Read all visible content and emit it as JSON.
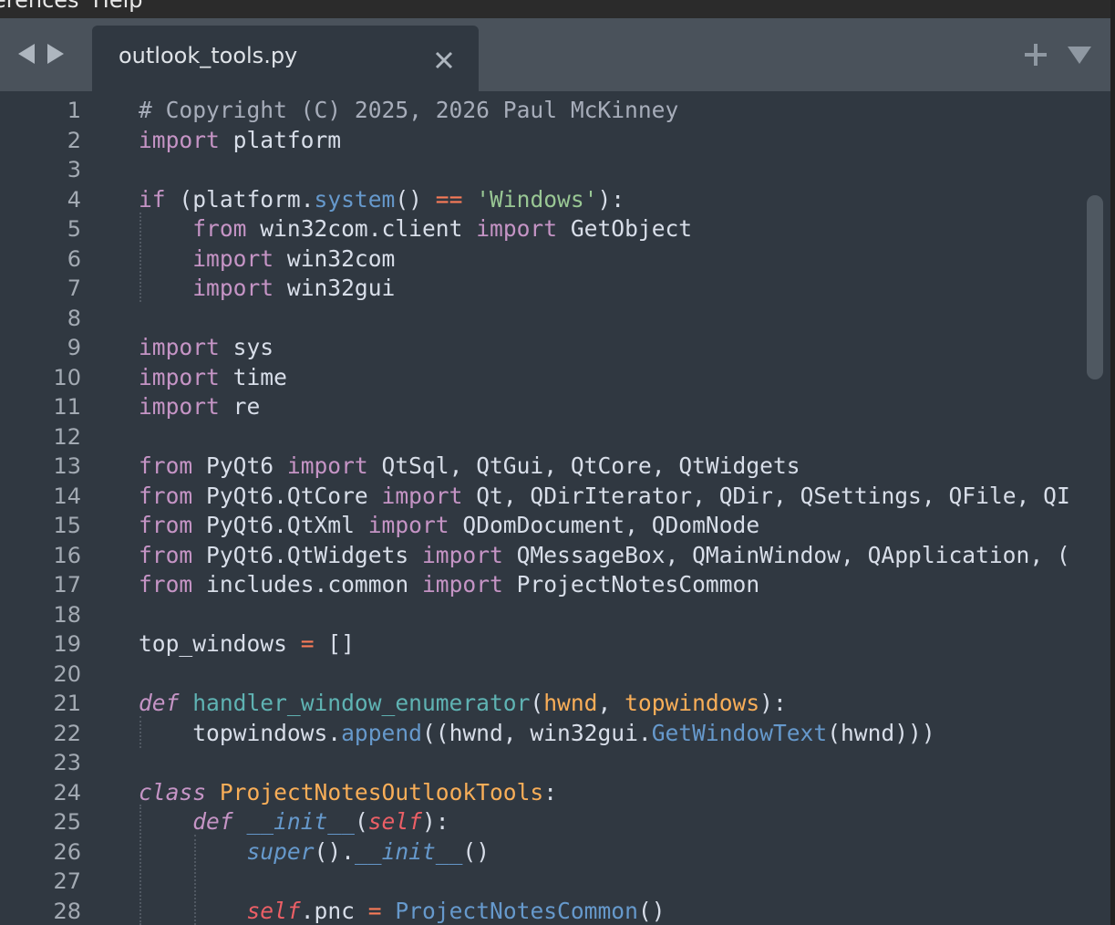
{
  "menubar": {
    "text": "erences  Help"
  },
  "tabs": [
    {
      "label": "outlook_tools.py",
      "close_icon": "close-icon",
      "active": true
    }
  ],
  "icons": {
    "back": "chevron-left-icon",
    "forward": "chevron-right-icon",
    "new_tab": "plus-icon",
    "tab_menu": "chevron-down-icon"
  },
  "theme": {
    "background": "#303841",
    "tabbar": "#4a525b",
    "comment": "#a7adba",
    "keyword": "#c594c5",
    "string": "#99c794",
    "operator": "#f97b58",
    "function": "#5fb3b3",
    "method": "#6699cc",
    "parameter": "#f9ae58",
    "self": "#ec5f66"
  },
  "editor": {
    "lines": [
      {
        "n": "1",
        "tokens": [
          [
            "comment",
            "# Copyright (C) 2025, 2026 Paul McKinney"
          ]
        ]
      },
      {
        "n": "2",
        "tokens": [
          [
            "kw",
            "import"
          ],
          [
            "plain",
            " platform"
          ]
        ]
      },
      {
        "n": "3",
        "tokens": []
      },
      {
        "n": "4",
        "tokens": [
          [
            "kw",
            "if"
          ],
          [
            "plain",
            " (platform"
          ],
          [
            "punc",
            "."
          ],
          [
            "method",
            "system"
          ],
          [
            "plain",
            "() "
          ],
          [
            "op",
            "=="
          ],
          [
            "plain",
            " "
          ],
          [
            "str",
            "'Windows'"
          ],
          [
            "plain",
            "):"
          ]
        ]
      },
      {
        "n": "5",
        "tokens": [
          [
            "plain",
            "    "
          ],
          [
            "kw",
            "from"
          ],
          [
            "plain",
            " win32com"
          ],
          [
            "punc",
            "."
          ],
          [
            "plain",
            "client "
          ],
          [
            "kw",
            "import"
          ],
          [
            "plain",
            " GetObject"
          ]
        ]
      },
      {
        "n": "6",
        "tokens": [
          [
            "plain",
            "    "
          ],
          [
            "kw",
            "import"
          ],
          [
            "plain",
            " win32com"
          ]
        ]
      },
      {
        "n": "7",
        "tokens": [
          [
            "plain",
            "    "
          ],
          [
            "kw",
            "import"
          ],
          [
            "plain",
            " win32gui"
          ]
        ]
      },
      {
        "n": "8",
        "tokens": []
      },
      {
        "n": "9",
        "tokens": [
          [
            "kw",
            "import"
          ],
          [
            "plain",
            " sys"
          ]
        ]
      },
      {
        "n": "10",
        "tokens": [
          [
            "kw",
            "import"
          ],
          [
            "plain",
            " time"
          ]
        ]
      },
      {
        "n": "11",
        "tokens": [
          [
            "kw",
            "import"
          ],
          [
            "plain",
            " re"
          ]
        ]
      },
      {
        "n": "12",
        "tokens": []
      },
      {
        "n": "13",
        "tokens": [
          [
            "kw",
            "from"
          ],
          [
            "plain",
            " PyQt6 "
          ],
          [
            "kw",
            "import"
          ],
          [
            "plain",
            " QtSql"
          ],
          [
            "punc",
            ","
          ],
          [
            "plain",
            " QtGui"
          ],
          [
            "punc",
            ","
          ],
          [
            "plain",
            " QtCore"
          ],
          [
            "punc",
            ","
          ],
          [
            "plain",
            " QtWidgets"
          ]
        ]
      },
      {
        "n": "14",
        "tokens": [
          [
            "kw",
            "from"
          ],
          [
            "plain",
            " PyQt6"
          ],
          [
            "punc",
            "."
          ],
          [
            "plain",
            "QtCore "
          ],
          [
            "kw",
            "import"
          ],
          [
            "plain",
            " Qt"
          ],
          [
            "punc",
            ","
          ],
          [
            "plain",
            " QDirIterator"
          ],
          [
            "punc",
            ","
          ],
          [
            "plain",
            " QDir"
          ],
          [
            "punc",
            ","
          ],
          [
            "plain",
            " QSettings"
          ],
          [
            "punc",
            ","
          ],
          [
            "plain",
            " QFile"
          ],
          [
            "punc",
            ","
          ],
          [
            "plain",
            " QI"
          ]
        ]
      },
      {
        "n": "15",
        "tokens": [
          [
            "kw",
            "from"
          ],
          [
            "plain",
            " PyQt6"
          ],
          [
            "punc",
            "."
          ],
          [
            "plain",
            "QtXml "
          ],
          [
            "kw",
            "import"
          ],
          [
            "plain",
            " QDomDocument"
          ],
          [
            "punc",
            ","
          ],
          [
            "plain",
            " QDomNode"
          ]
        ]
      },
      {
        "n": "16",
        "tokens": [
          [
            "kw",
            "from"
          ],
          [
            "plain",
            " PyQt6"
          ],
          [
            "punc",
            "."
          ],
          [
            "plain",
            "QtWidgets "
          ],
          [
            "kw",
            "import"
          ],
          [
            "plain",
            " QMessageBox"
          ],
          [
            "punc",
            ","
          ],
          [
            "plain",
            " QMainWindow"
          ],
          [
            "punc",
            ","
          ],
          [
            "plain",
            " QApplication"
          ],
          [
            "punc",
            ","
          ],
          [
            "plain",
            " ("
          ]
        ]
      },
      {
        "n": "17",
        "tokens": [
          [
            "kw",
            "from"
          ],
          [
            "plain",
            " includes"
          ],
          [
            "punc",
            "."
          ],
          [
            "plain",
            "common "
          ],
          [
            "kw",
            "import"
          ],
          [
            "plain",
            " ProjectNotesCommon"
          ]
        ]
      },
      {
        "n": "18",
        "tokens": []
      },
      {
        "n": "19",
        "tokens": [
          [
            "plain",
            "top_windows "
          ],
          [
            "op",
            "="
          ],
          [
            "plain",
            " []"
          ]
        ]
      },
      {
        "n": "20",
        "tokens": []
      },
      {
        "n": "21",
        "tokens": [
          [
            "def",
            "def"
          ],
          [
            "plain",
            " "
          ],
          [
            "fn",
            "handler_window_enumerator"
          ],
          [
            "plain",
            "("
          ],
          [
            "param",
            "hwnd"
          ],
          [
            "punc",
            ","
          ],
          [
            "plain",
            " "
          ],
          [
            "param",
            "topwindows"
          ],
          [
            "plain",
            "):"
          ]
        ]
      },
      {
        "n": "22",
        "tokens": [
          [
            "plain",
            "    topwindows"
          ],
          [
            "punc",
            "."
          ],
          [
            "method",
            "append"
          ],
          [
            "plain",
            "((hwnd"
          ],
          [
            "punc",
            ","
          ],
          [
            "plain",
            " win32gui"
          ],
          [
            "punc",
            "."
          ],
          [
            "method",
            "GetWindowText"
          ],
          [
            "plain",
            "(hwnd)))"
          ]
        ]
      },
      {
        "n": "23",
        "tokens": []
      },
      {
        "n": "24",
        "tokens": [
          [
            "def",
            "class"
          ],
          [
            "plain",
            " "
          ],
          [
            "class",
            "ProjectNotesOutlookTools"
          ],
          [
            "plain",
            ":"
          ]
        ]
      },
      {
        "n": "25",
        "tokens": [
          [
            "plain",
            "    "
          ],
          [
            "def",
            "def"
          ],
          [
            "plain",
            " "
          ],
          [
            "magic",
            "__init__"
          ],
          [
            "plain",
            "("
          ],
          [
            "self",
            "self"
          ],
          [
            "plain",
            "):"
          ]
        ]
      },
      {
        "n": "26",
        "tokens": [
          [
            "plain",
            "        "
          ],
          [
            "magic",
            "super"
          ],
          [
            "plain",
            "()"
          ],
          [
            "punc",
            "."
          ],
          [
            "magic",
            "__init__"
          ],
          [
            "plain",
            "()"
          ]
        ]
      },
      {
        "n": "27",
        "tokens": []
      },
      {
        "n": "28",
        "tokens": [
          [
            "plain",
            "        "
          ],
          [
            "self",
            "self"
          ],
          [
            "punc",
            "."
          ],
          [
            "plain",
            "pnc "
          ],
          [
            "op",
            "="
          ],
          [
            "plain",
            " "
          ],
          [
            "method",
            "ProjectNotesCommon"
          ],
          [
            "plain",
            "()"
          ]
        ]
      }
    ]
  }
}
